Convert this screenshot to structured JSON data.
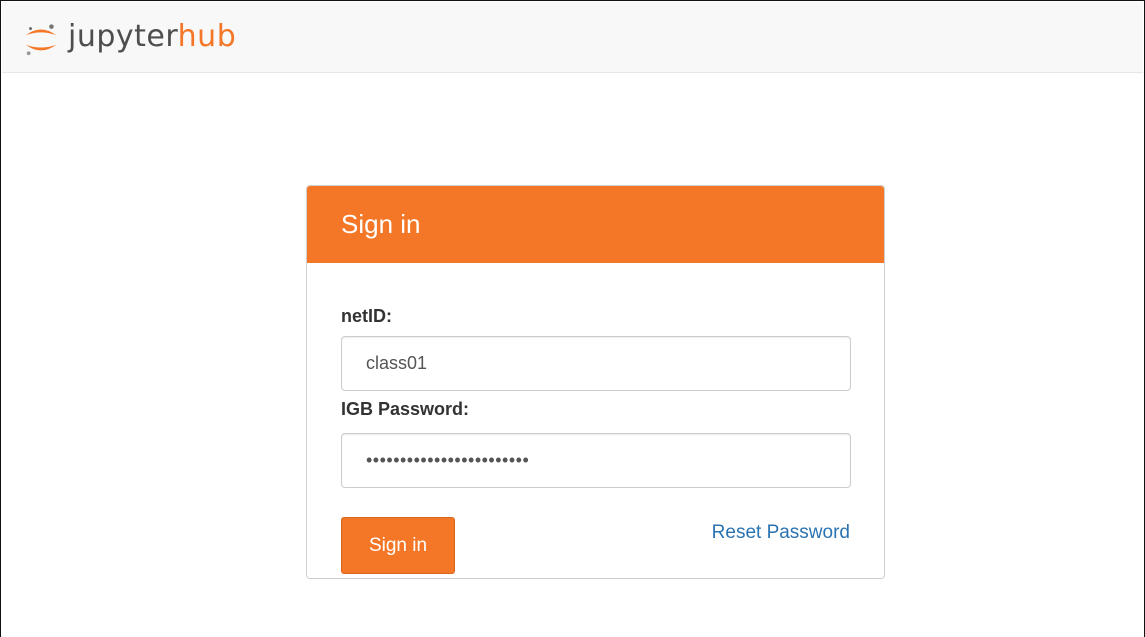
{
  "navbar": {
    "logo": {
      "part1": "jupyter",
      "part2": "hub",
      "icon": "jupyter-logo-icon"
    }
  },
  "login": {
    "title": "Sign in",
    "username_label": "netID:",
    "username_value": "class01",
    "password_label": "IGB Password:",
    "password_value": "••••••••••••••••••••••••",
    "submit_label": "Sign in",
    "reset_label": "Reset Password"
  },
  "colors": {
    "accent": "#f37726",
    "link": "#2a73b2",
    "navbar_bg": "#f8f8f8"
  }
}
